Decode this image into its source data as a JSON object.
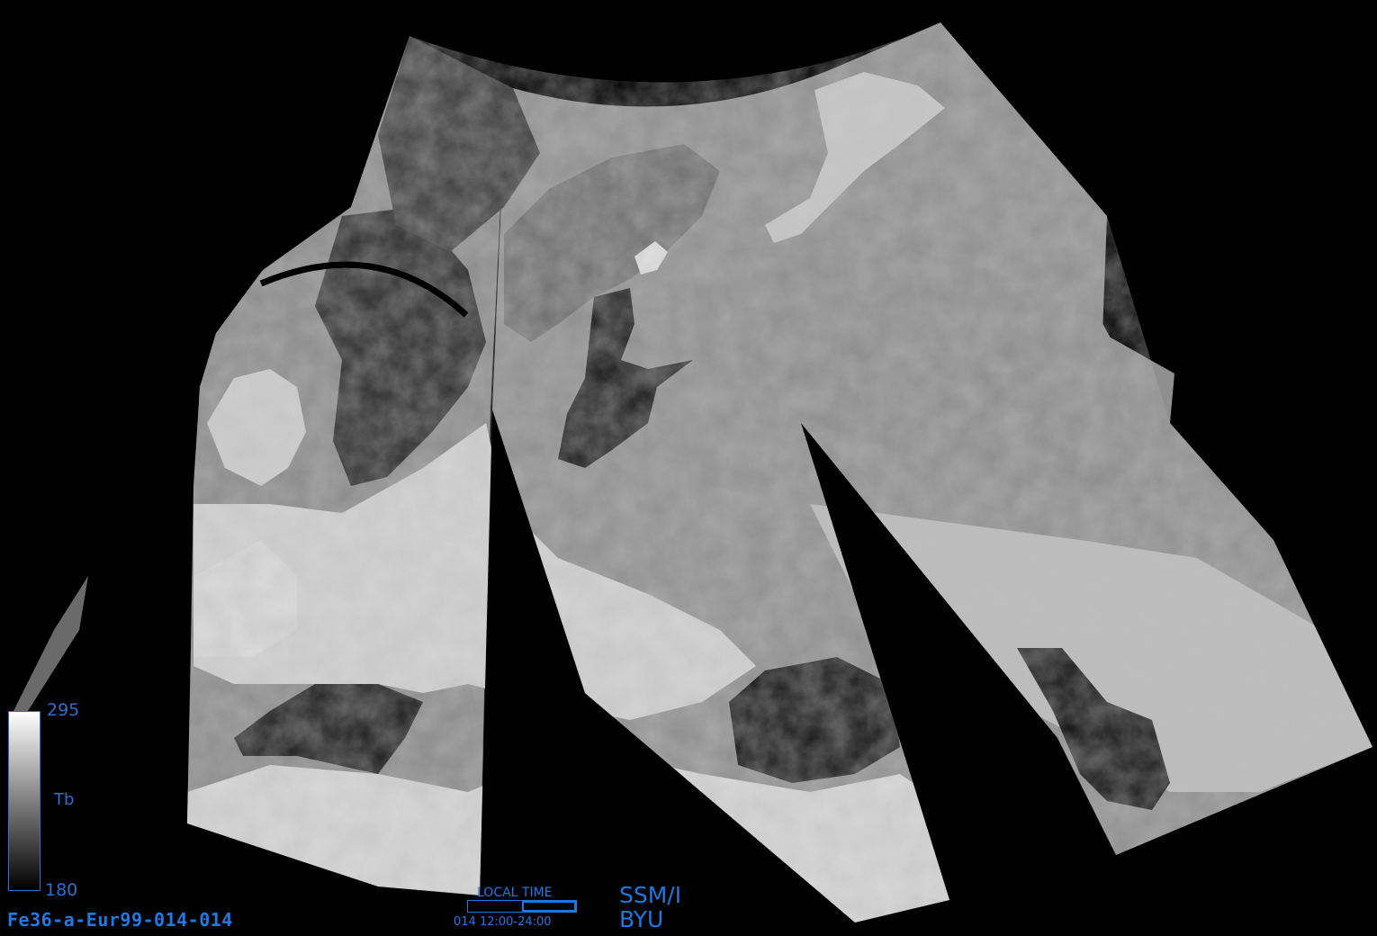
{
  "colorbar": {
    "max_label": "295",
    "min_label": "180",
    "variable_label": "Tb"
  },
  "product_id": "Fe36-a-Eur99-014-014",
  "local_time": {
    "title": "LOCAL TIME",
    "range": "014 12:00-24:00",
    "fill_fraction": 0.5
  },
  "sensor": "SSM/I",
  "org": "BYU",
  "colors": {
    "background": "#000000",
    "label_blue": "#1f78e0"
  }
}
